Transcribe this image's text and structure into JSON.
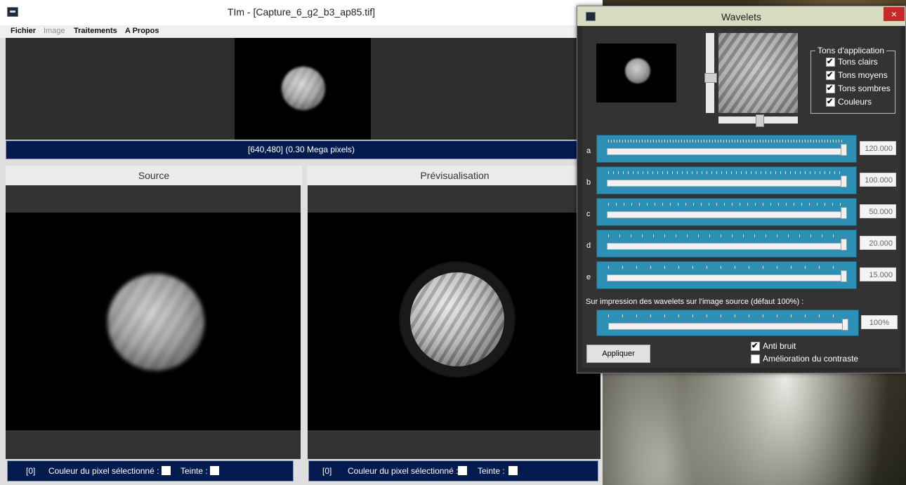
{
  "main_window": {
    "title": "TIm - [Capture_6_g2_b3_ap85.tif]",
    "menu": [
      "Fichier",
      "Image",
      "Traitements",
      "A Propos"
    ],
    "image_info": "[640,480] (0.30 Mega pixels)",
    "source_title": "Source",
    "preview_title": "Prévisualisation",
    "status_left": {
      "index": "[0]",
      "pixel_color_label": "Couleur du pixel sélectionné :",
      "tint_label": "Teinte :"
    },
    "status_right": {
      "index": "[0]",
      "pixel_color_label": "Couleur du pixel sélectionné :",
      "tint_label": "Teinte :"
    }
  },
  "wavelets": {
    "title": "Wavelets",
    "close": "×",
    "tones_legend": "Tons d'application",
    "tones": [
      {
        "label": "Tons clairs",
        "checked": true
      },
      {
        "label": "Tons moyens",
        "checked": true
      },
      {
        "label": "Tons sombres",
        "checked": true
      },
      {
        "label": "Couleurs",
        "checked": true
      }
    ],
    "sliders": [
      {
        "letter": "a",
        "value": "120.000",
        "level": 1.0
      },
      {
        "letter": "b",
        "value": "100.000",
        "level": 1.0
      },
      {
        "letter": "c",
        "value": "50.000",
        "level": 1.0
      },
      {
        "letter": "d",
        "value": "20.000",
        "level": 1.0
      },
      {
        "letter": "e",
        "value": "15.000",
        "level": 1.0
      }
    ],
    "overlay_label": "Sur impression des wavelets sur l'image source (défaut 100%) :",
    "overlay_value": "100%",
    "overlay_level": 1.0,
    "apply_label": "Appliquer",
    "anti_noise": {
      "label": "Anti bruit",
      "checked": true
    },
    "contrast": {
      "label": "Amélioration du contraste",
      "checked": false
    }
  }
}
